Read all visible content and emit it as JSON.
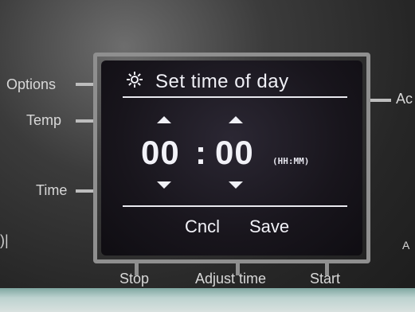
{
  "side_buttons": {
    "options": "Options",
    "temp": "Temp",
    "time": "Time",
    "adjust_cut": "Ac",
    "a_cut": "A"
  },
  "bottom_buttons": {
    "stop": "Stop",
    "adjust_time": "Adjust time",
    "start": "Start"
  },
  "screen": {
    "title": "Set time of day",
    "title_icon": "gear-icon",
    "hours": "00",
    "separator": ":",
    "minutes": "00",
    "format": "(HH:MM)",
    "cancel_label": "Cncl",
    "save_label": "Save"
  },
  "colors": {
    "screen_text": "#f0f0f6",
    "bezel": "#8f8f8f",
    "panel_label": "#d8d8d8"
  }
}
